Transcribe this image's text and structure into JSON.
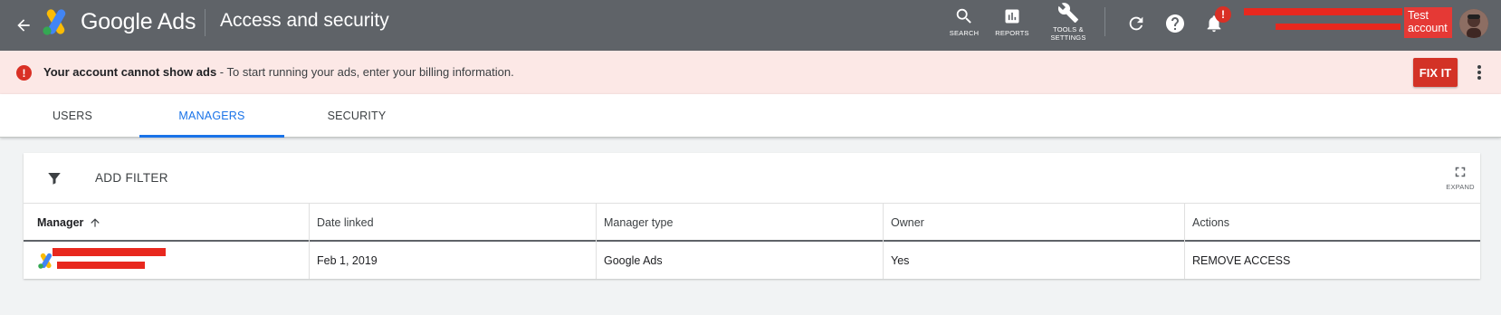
{
  "header": {
    "product_name": "Google Ads",
    "page_title": "Access and security",
    "tools": [
      {
        "label": "SEARCH",
        "icon": "search-icon"
      },
      {
        "label": "REPORTS",
        "icon": "reports-icon"
      },
      {
        "label": "TOOLS &\nSETTINGS",
        "icon": "wrench-icon"
      }
    ],
    "notification_badge": "!",
    "account_badge": "Test account"
  },
  "banner": {
    "title": "Your account cannot show ads",
    "message": " - To start running your ads, enter your billing information.",
    "fix_label": "FIX IT"
  },
  "tabs": [
    {
      "label": "USERS",
      "active": false
    },
    {
      "label": "MANAGERS",
      "active": true
    },
    {
      "label": "SECURITY",
      "active": false
    }
  ],
  "table": {
    "add_filter_label": "ADD FILTER",
    "expand_label": "EXPAND",
    "columns": [
      "Manager",
      "Date linked",
      "Manager type",
      "Owner",
      "Actions"
    ],
    "rows": [
      {
        "manager": "",
        "date_linked": "Feb 1, 2019",
        "manager_type": "Google Ads",
        "owner": "Yes",
        "action": "REMOVE ACCESS"
      }
    ]
  },
  "colors": {
    "header_bg": "#5f6368",
    "banner_bg": "#fce8e6",
    "error_red": "#d93025",
    "accent_blue": "#1a73e8"
  }
}
